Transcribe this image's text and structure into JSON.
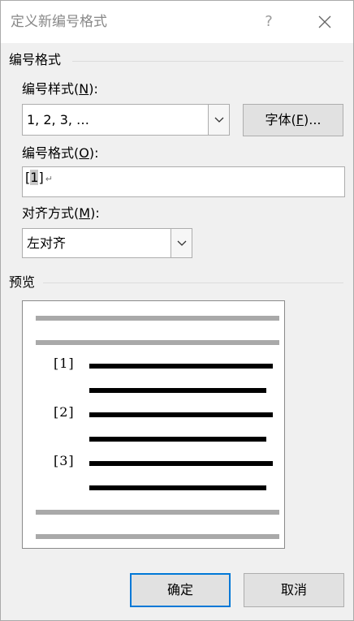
{
  "window": {
    "title": "定义新编号格式",
    "help_label": "?"
  },
  "number_format_group": {
    "heading": "编号格式",
    "style_label": "编号样式",
    "style_hotkey": "N",
    "style_value": "1, 2, 3, …",
    "font_button_label": "字体",
    "font_button_hotkey": "F",
    "format_label": "编号格式",
    "format_hotkey": "O",
    "format_value_open": "[",
    "format_value_field": "1",
    "format_value_close": "]",
    "alignment_label": "对齐方式",
    "alignment_hotkey": "M",
    "alignment_value": "左对齐"
  },
  "preview_group": {
    "heading": "预览",
    "numbers": [
      "[1]",
      "[2]",
      "[3]"
    ]
  },
  "footer": {
    "ok_label": "确定",
    "cancel_label": "取消"
  }
}
